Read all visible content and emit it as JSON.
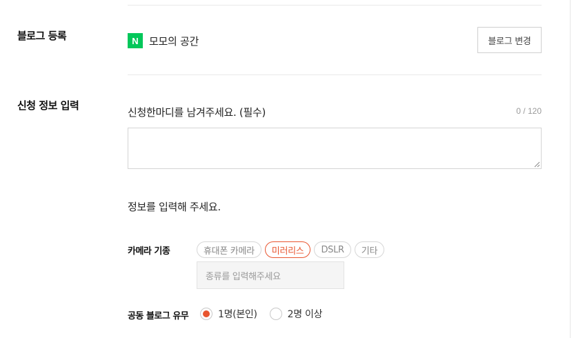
{
  "blog_section": {
    "label": "블로그 등록",
    "icon_letter": "N",
    "blog_name": "모모의 공간",
    "change_button": "블로그 변경"
  },
  "info_section": {
    "label": "신청 정보 입력",
    "comment_label": "신청한마디를 남겨주세요. (필수)",
    "comment_count": "0 / 120",
    "comment_value": "",
    "info_prompt": "정보를 입력해 주세요."
  },
  "camera_type": {
    "label": "카메라 기종",
    "options": [
      {
        "label": "휴대폰 카메라",
        "selected": false
      },
      {
        "label": "미러리스",
        "selected": true
      },
      {
        "label": "DSLR",
        "selected": false
      },
      {
        "label": "기타",
        "selected": false
      }
    ],
    "input_placeholder": "종류를 입력해주세요"
  },
  "co_blog": {
    "label": "공동 블로그 유무",
    "options": [
      {
        "label": "1명(본인)",
        "selected": true
      },
      {
        "label": "2명 이상",
        "selected": false
      }
    ]
  },
  "colors": {
    "accent": "#e8552f",
    "naver_green": "#03c75a"
  }
}
